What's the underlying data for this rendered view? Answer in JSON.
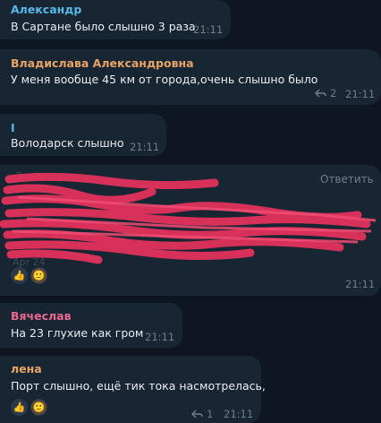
{
  "messages": [
    {
      "sender": "Александр",
      "sender_color": "#59b7e8",
      "text": "В Сартане было слышно 3 раза",
      "time": "21:11"
    },
    {
      "sender": "Владислава Александровна",
      "sender_color": "#e8a464",
      "text": "У меня вообще 45 км от города,очень слышно было",
      "time": "21:11",
      "reply_count": "2"
    },
    {
      "sender": "I",
      "sender_color": "#59b7e8",
      "text": "Володарск слышно",
      "time": "21:11"
    },
    {
      "reply_label": "Ответить",
      "time": "21:11",
      "reactions": [
        "thumbs-up",
        "avatar"
      ],
      "redacted": true,
      "faint_lines": [
        "Reply…",
        "Apr 24"
      ]
    },
    {
      "sender": "Вячеслав",
      "sender_color": "#e8698f",
      "text": "На 23 глухие как гром",
      "time": "21:11"
    },
    {
      "sender": "лена",
      "sender_color": "#e8a464",
      "text": "Порт слышно, ещё тик тока насмотрелась,",
      "time": "21:11",
      "reply_count": "1",
      "reactions": [
        "thumbs-up",
        "avatar"
      ]
    }
  ],
  "emoji": {
    "thumbs": "👍",
    "avatar": "🙂"
  }
}
